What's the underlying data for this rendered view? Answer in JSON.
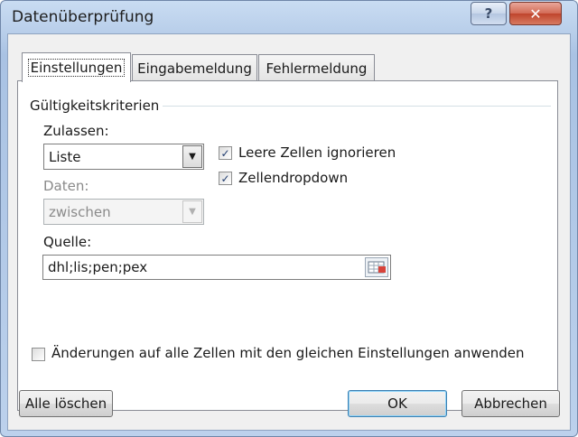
{
  "window": {
    "title": "Datenüberprüfung",
    "help_glyph": "?",
    "close_glyph": "✕"
  },
  "tabs": [
    {
      "label": "Einstellungen",
      "active": true
    },
    {
      "label": "Eingabemeldung",
      "active": false
    },
    {
      "label": "Fehlermeldung",
      "active": false
    }
  ],
  "settings": {
    "group_label": "Gültigkeitskriterien",
    "allow_label": "Zulassen:",
    "allow_value": "Liste",
    "data_label": "Daten:",
    "data_value": "zwischen",
    "ignore_blank_label": "Leere Zellen ignorieren",
    "ignore_blank_checked": true,
    "in_cell_dropdown_label": "Zellendropdown",
    "in_cell_dropdown_checked": true,
    "source_label": "Quelle:",
    "source_value": "dhl;lis;pen;pex",
    "apply_all_label": "Änderungen auf alle Zellen mit den gleichen Einstellungen anwenden",
    "apply_all_checked": false
  },
  "buttons": {
    "clear_all": "Alle löschen",
    "ok": "OK",
    "cancel": "Abbrechen"
  },
  "icons": {
    "dropdown": "chevron-down-icon",
    "range_select": "range-select-icon",
    "check": "checkmark-icon"
  },
  "colors": {
    "title_bar": "#b7cde9",
    "close_button": "#c0442c",
    "default_button_border": "#3c7fb1"
  }
}
